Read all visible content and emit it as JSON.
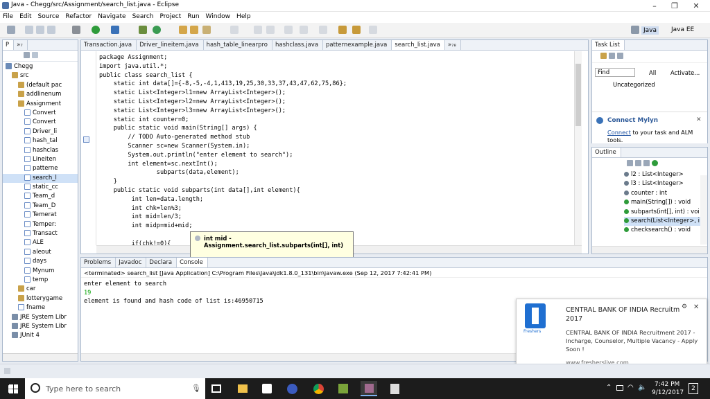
{
  "window": {
    "title": "Java - Chegg/src/Assignment/search_list.java - Eclipse",
    "min": "–",
    "max": "❐",
    "close": "✕"
  },
  "menu": [
    "File",
    "Edit",
    "Source",
    "Refactor",
    "Navigate",
    "Search",
    "Project",
    "Run",
    "Window",
    "Help"
  ],
  "perspectives": {
    "java": "Java",
    "javaee": "Java EE"
  },
  "explorer": {
    "tab": "P",
    "tab_more": "»₇",
    "items": [
      {
        "label": "Chegg",
        "indent": 0,
        "kind": "project"
      },
      {
        "label": "src",
        "indent": 1,
        "kind": "src"
      },
      {
        "label": "(default pac",
        "indent": 2,
        "kind": "pkg"
      },
      {
        "label": "addlinenum",
        "indent": 2,
        "kind": "pkg"
      },
      {
        "label": "Assignment",
        "indent": 2,
        "kind": "pkg"
      },
      {
        "label": "Convert",
        "indent": 3,
        "kind": "java"
      },
      {
        "label": "Convert",
        "indent": 3,
        "kind": "java"
      },
      {
        "label": "Driver_li",
        "indent": 3,
        "kind": "java"
      },
      {
        "label": "hash_tal",
        "indent": 3,
        "kind": "java"
      },
      {
        "label": "hashclas",
        "indent": 3,
        "kind": "java"
      },
      {
        "label": "Lineiten",
        "indent": 3,
        "kind": "java"
      },
      {
        "label": "patterne",
        "indent": 3,
        "kind": "java"
      },
      {
        "label": "search_l",
        "indent": 3,
        "kind": "java",
        "selected": true
      },
      {
        "label": "static_cc",
        "indent": 3,
        "kind": "java"
      },
      {
        "label": "Team_d",
        "indent": 3,
        "kind": "java"
      },
      {
        "label": "Team_D",
        "indent": 3,
        "kind": "java"
      },
      {
        "label": "Temerat",
        "indent": 3,
        "kind": "java"
      },
      {
        "label": "Temper:",
        "indent": 3,
        "kind": "java"
      },
      {
        "label": "Transact",
        "indent": 3,
        "kind": "java"
      },
      {
        "label": "ALE",
        "indent": 3,
        "kind": "file"
      },
      {
        "label": "aleout",
        "indent": 3,
        "kind": "file"
      },
      {
        "label": "days",
        "indent": 3,
        "kind": "file"
      },
      {
        "label": "Mynum",
        "indent": 3,
        "kind": "file"
      },
      {
        "label": "temp",
        "indent": 3,
        "kind": "file"
      },
      {
        "label": "car",
        "indent": 2,
        "kind": "pkg"
      },
      {
        "label": "lotterygame",
        "indent": 2,
        "kind": "pkg"
      },
      {
        "label": "fname",
        "indent": 2,
        "kind": "file"
      },
      {
        "label": "JRE System Libr",
        "indent": 1,
        "kind": "lib"
      },
      {
        "label": "JRE System Libr",
        "indent": 1,
        "kind": "lib"
      },
      {
        "label": "JUnit 4",
        "indent": 1,
        "kind": "lib"
      }
    ]
  },
  "editor_tabs": [
    "Transaction.java",
    "Driver_lineitem.java",
    "hash_table_linearpro",
    "hashclass.java",
    "patternexample.java",
    "search_list.java",
    "»₇₈"
  ],
  "code": [
    [
      "package Assignment;"
    ],
    [
      "import java.util.*;"
    ],
    [
      "public class search_list {"
    ],
    [
      "    static int data[]={-8,-5,-4,1,413,19,25,30,33,37,43,47,62,75,86};"
    ],
    [
      "    static List<Integer>l1=new ArrayList<Integer>();"
    ],
    [
      "    static List<Integer>l2=new ArrayList<Integer>();"
    ],
    [
      "    static List<Integer>l3=new ArrayList<Integer>();"
    ],
    [
      "    static int counter=0;"
    ],
    [
      "    public static void main(String[] args) {"
    ],
    [
      "        // TODO Auto-generated method stub"
    ],
    [
      "        Scanner sc=new Scanner(System.in);"
    ],
    [
      "        System.out.println(\"enter element to search\");"
    ],
    [
      "        int element=sc.nextInt();"
    ],
    [
      "                subparts(data,element);"
    ],
    [
      "    }"
    ],
    [
      "    public static void subparts(int data[],int element){"
    ],
    [
      "         int len=data.length;"
    ],
    [
      "         int chk=len%3;"
    ],
    [
      "         int mid=len/3;"
    ],
    [
      "         int midp=mid+mid;"
    ],
    [
      ""
    ],
    [
      "         if(chk!=0){"
    ]
  ],
  "hover": {
    "text": "int mid - Assignment.search_list.subparts(int[], int)"
  },
  "tasklist": {
    "tab": "Task List",
    "find_placeholder": "Find",
    "all": "All",
    "activate": "Activate...",
    "uncategorized": "Uncategorized"
  },
  "mylyn": {
    "title": "Connect Mylyn",
    "link": "Connect",
    "text": " to your task and ALM tools."
  },
  "outline": {
    "tab": "Outline",
    "items": [
      {
        "label": "l2 : List<Integer>",
        "kind": "field"
      },
      {
        "label": "l3 : List<Integer>",
        "kind": "field"
      },
      {
        "label": "counter : int",
        "kind": "field"
      },
      {
        "label": "main(String[]) : void",
        "kind": "method"
      },
      {
        "label": "subparts(int[], int) : voi",
        "kind": "method"
      },
      {
        "label": "search(List<Integer>, i",
        "kind": "method",
        "selected": true
      },
      {
        "label": "checksearch() : void",
        "kind": "method"
      }
    ]
  },
  "bottom_tabs": [
    "Problems",
    "Javadoc",
    "Declara",
    "Console"
  ],
  "console": {
    "header": "<terminated> search_list [Java Application] C:\\Program Files\\Java\\jdk1.8.0_131\\bin\\javaw.exe (Sep 12, 2017 7:42:41 PM)",
    "lines": [
      "enter element to search",
      "19",
      "element is found and hash code of list is:46950715"
    ]
  },
  "notification": {
    "title": "CENTRAL BANK OF INDIA Recruitm",
    "subtitle": "2017",
    "body": "CENTRAL BANK OF INDIA Recruitment 2017 - Incharge, Counselor, Multiple Vacancy - Apply Soon !",
    "source": "www.fresherslive.com",
    "brand": "Freshers"
  },
  "taskbar": {
    "search_placeholder": "Type here to search",
    "time": "7:42 PM",
    "date": "9/12/2017",
    "badge": "2"
  },
  "colors": {
    "accent": "#0078d7",
    "selection": "#cfe1f7",
    "taskbar": "#1c1c1c"
  }
}
